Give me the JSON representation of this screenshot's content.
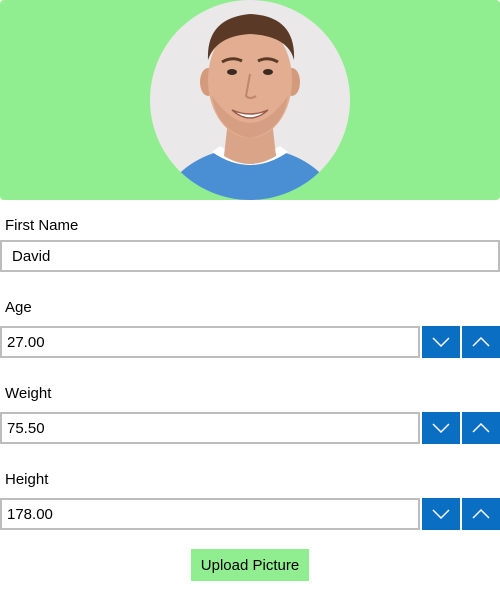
{
  "header": {
    "background_color": "#90ee90"
  },
  "form": {
    "first_name": {
      "label": "First Name",
      "value": "David"
    },
    "age": {
      "label": "Age",
      "value": "27.00"
    },
    "weight": {
      "label": "Weight",
      "value": "75.50"
    },
    "height": {
      "label": "Height",
      "value": "178.00"
    }
  },
  "spinner": {
    "button_color": "#0a6ec3",
    "decrement_icon": "chevron-down-icon",
    "increment_icon": "chevron-up-icon"
  },
  "actions": {
    "upload_label": "Upload Picture",
    "upload_color": "#90ee90"
  }
}
